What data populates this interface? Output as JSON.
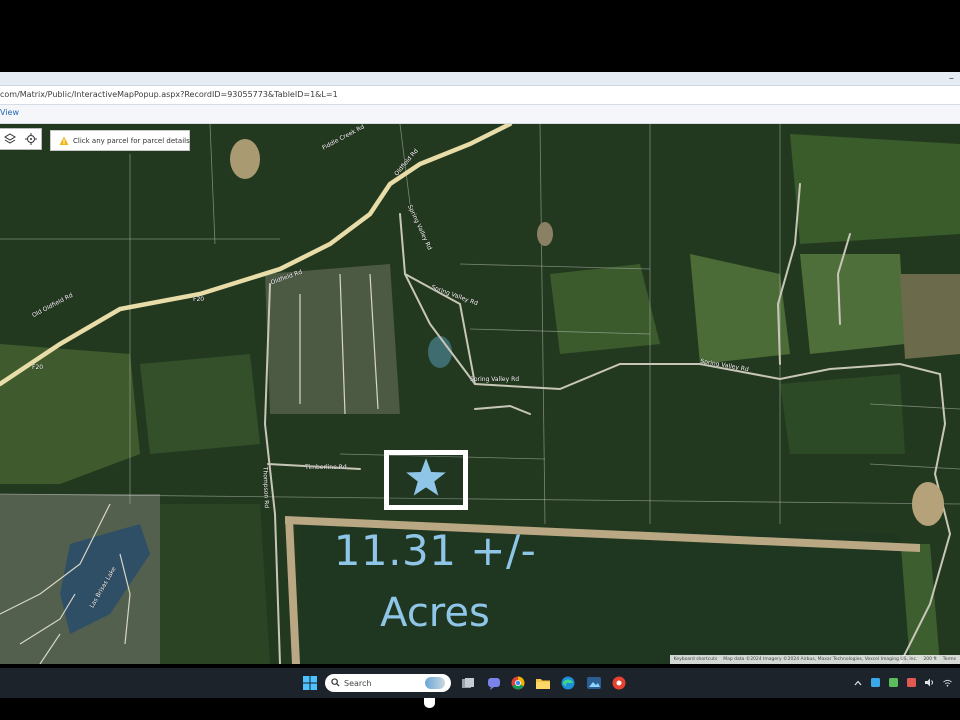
{
  "browser": {
    "url": "com/Matrix/Public/InteractiveMapPopup.aspx?RecordID=93055773&TableID=1&L=1",
    "tab_label": "View",
    "minimize_glyph": "–"
  },
  "map": {
    "hint_text": "Click any parcel for parcel details.",
    "controls": [
      {
        "icon": "layers-icon"
      },
      {
        "icon": "locate-icon"
      }
    ],
    "road_labels": {
      "oldfield_rd_1": "Old Oldfield Rd",
      "oldfield_rd_2": "Oldfield Rd",
      "oldfield_rd_3": "Oldfield Rd",
      "fiddle_creek": "Fiddle Creek Rd",
      "spring_valley_1": "Spring Valley Rd",
      "spring_valley_2": "Spring Valley Rd",
      "spring_valley_3": "Spring Valley Rd",
      "spring_valley_4": "Spring Valley Rd",
      "timberline": "Timberline Rd",
      "thompson": "Thompson Rd",
      "las_brisas_lake": "Las Brisas Lake",
      "route_marker_1": "F20",
      "route_marker_2": "F20"
    },
    "marker_icon": "star-icon",
    "acreage": "11.31 +/-",
    "acreage_unit": "Acres",
    "attribution": {
      "shortcuts": "Keyboard shortcuts",
      "data": "Map data ©2024 Imagery ©2024 Airbus, Maxar Technologies, Vexcel Imaging US, Inc.",
      "scale": "200 ft",
      "terms": "Terms"
    }
  },
  "taskbar": {
    "search_placeholder": "Search",
    "apps": [
      "windows-start-icon",
      "search-icon",
      "task-view-icon",
      "teams-chat-icon",
      "chrome-icon",
      "file-explorer-icon",
      "edge-icon",
      "photos-icon",
      "snipping-tool-icon"
    ],
    "tray": [
      "chevron-up-icon",
      "security-icon",
      "network-icon",
      "battery-icon",
      "speaker-icon",
      "wifi-icon"
    ]
  },
  "colors": {
    "acreage_text": "#8fc6e8",
    "forest": "#233920",
    "road_major": "#e8dca8",
    "taskbar": "#1d232b"
  }
}
